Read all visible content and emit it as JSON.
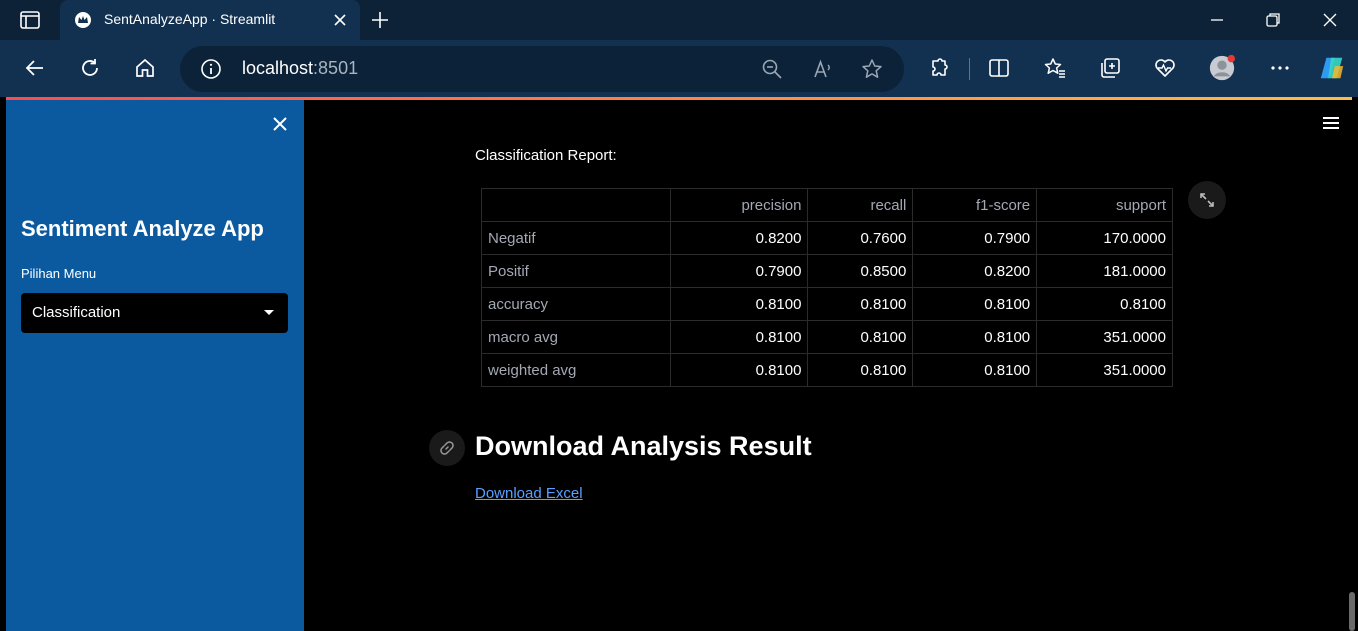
{
  "browser": {
    "tab_title": "SentAnalyzeApp · Streamlit",
    "url_host": "localhost",
    "url_port": ":8501"
  },
  "sidebar": {
    "app_title": "Sentiment Analyze App",
    "menu_label": "Pilihan Menu",
    "menu_selected": "Classification"
  },
  "main": {
    "report_label": "Classification Report:",
    "table": {
      "headers": [
        "",
        "precision",
        "recall",
        "f1-score",
        "support"
      ],
      "rows": [
        {
          "name": "Negatif",
          "precision": "0.8200",
          "recall": "0.7600",
          "f1": "0.7900",
          "support": "170.0000"
        },
        {
          "name": "Positif",
          "precision": "0.7900",
          "recall": "0.8500",
          "f1": "0.8200",
          "support": "181.0000"
        },
        {
          "name": "accuracy",
          "precision": "0.8100",
          "recall": "0.8100",
          "f1": "0.8100",
          "support": "0.8100"
        },
        {
          "name": "macro avg",
          "precision": "0.8100",
          "recall": "0.8100",
          "f1": "0.8100",
          "support": "351.0000"
        },
        {
          "name": "weighted avg",
          "precision": "0.8100",
          "recall": "0.8100",
          "f1": "0.8100",
          "support": "351.0000"
        }
      ]
    },
    "section_title": "Download Analysis Result",
    "download_link": "Download Excel"
  },
  "colors": {
    "sidebar_bg": "#0b5aa0",
    "link": "#5aa0ff",
    "accent_start": "#ff4b4b",
    "accent_end": "#ffbd45"
  }
}
